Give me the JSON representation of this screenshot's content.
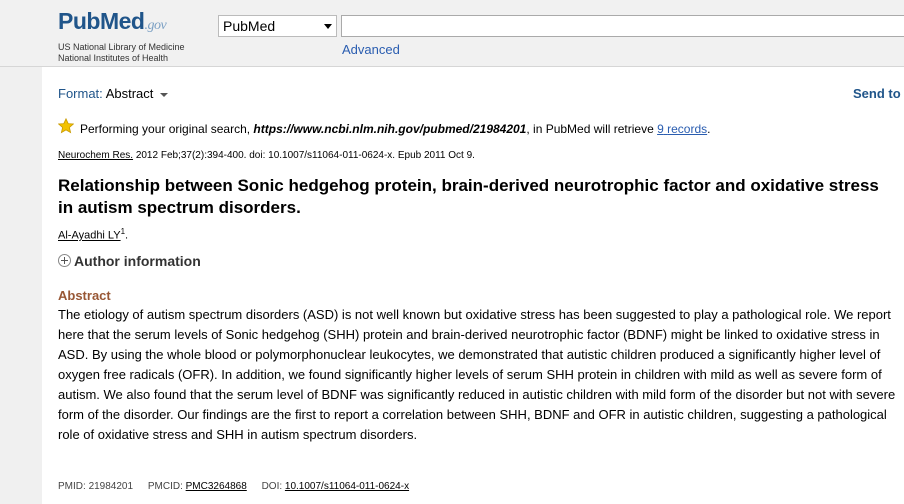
{
  "header": {
    "logo": {
      "pub": "Pub",
      "med": "Med",
      "gov": ".gov"
    },
    "org_line1": "US National Library of Medicine",
    "org_line2": "National Institutes of Health",
    "database": "PubMed",
    "search_value": "",
    "advanced": "Advanced"
  },
  "toolbar": {
    "format_label": "Format:",
    "format_value": "Abstract",
    "send_to": "Send to"
  },
  "notice": {
    "prefix": "Performing your original search,",
    "query": "https://www.ncbi.nlm.nih.gov/pubmed/21984201",
    "middle": ", in PubMed will retrieve",
    "count": "9",
    "records": "records",
    "suffix": "."
  },
  "citation": {
    "journal": "Neurochem Res.",
    "details": "2012 Feb;37(2):394-400. doi: 10.1007/s11064-011-0624-x. Epub 2011 Oct 9."
  },
  "article": {
    "title": "Relationship between Sonic hedgehog protein, brain-derived neurotrophic factor and oxidative stress in autism spectrum disorders.",
    "author": "Al-Ayadhi LY",
    "author_sup": "1",
    "author_info": "Author information",
    "abstract_heading": "Abstract",
    "abstract": "The etiology of autism spectrum disorders (ASD) is not well known but oxidative stress has been suggested to play a pathological role. We report here that the serum levels of Sonic hedgehog (SHH) protein and brain-derived neurotrophic factor (BDNF) might be linked to oxidative stress in ASD. By using the whole blood or polymorphonuclear leukocytes, we demonstrated that autistic children produced a significantly higher level of oxygen free radicals (OFR). In addition, we found significantly higher levels of serum SHH protein in children with mild as well as severe form of autism. We also found that the serum level of BDNF was significantly reduced in autistic children with mild form of the disorder but not with severe form of the disorder. Our findings are the first to report a correlation between SHH, BDNF and OFR in autistic children, suggesting a pathological role of oxidative stress and SHH in autism spectrum disorders."
  },
  "ids": {
    "pmid_label": "PMID:",
    "pmid": "21984201",
    "pmcid_label": "PMCID:",
    "pmcid": "PMC3264868",
    "doi_label": "DOI:",
    "doi": "10.1007/s11064-011-0624-x"
  },
  "colors": {
    "brand": "#20558a",
    "link": "#2a5db0",
    "abstract_heading": "#985735",
    "star": "#f2c200"
  }
}
